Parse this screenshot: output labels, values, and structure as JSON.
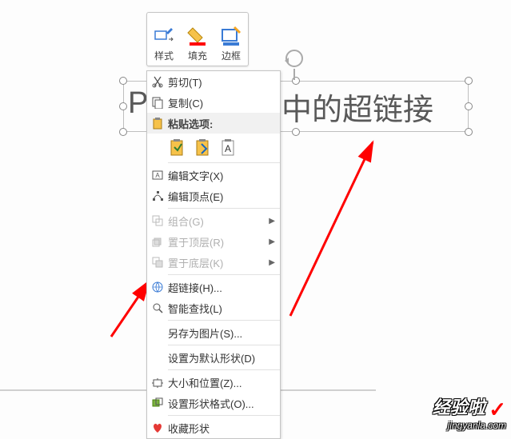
{
  "ribbon": {
    "style": "样式",
    "fill": "填充",
    "border": "边框"
  },
  "textbox": {
    "left": "PP",
    "right": "中的超链接"
  },
  "menu": {
    "cut": "剪切(T)",
    "copy": "复制(C)",
    "pasteHeader": "粘贴选项:",
    "editText": "编辑文字(X)",
    "editPoints": "编辑顶点(E)",
    "group": "组合(G)",
    "bringFront": "置于顶层(R)",
    "sendBack": "置于底层(K)",
    "hyperlink": "超链接(H)...",
    "smartLookup": "智能查找(L)",
    "saveAsPic": "另存为图片(S)...",
    "setDefault": "设置为默认形状(D)",
    "sizePos": "大小和位置(Z)...",
    "formatShape": "设置形状格式(O)...",
    "favorite": "收藏形状"
  },
  "watermark": {
    "main": "经验啦",
    "sub": "jingyanla.com"
  }
}
